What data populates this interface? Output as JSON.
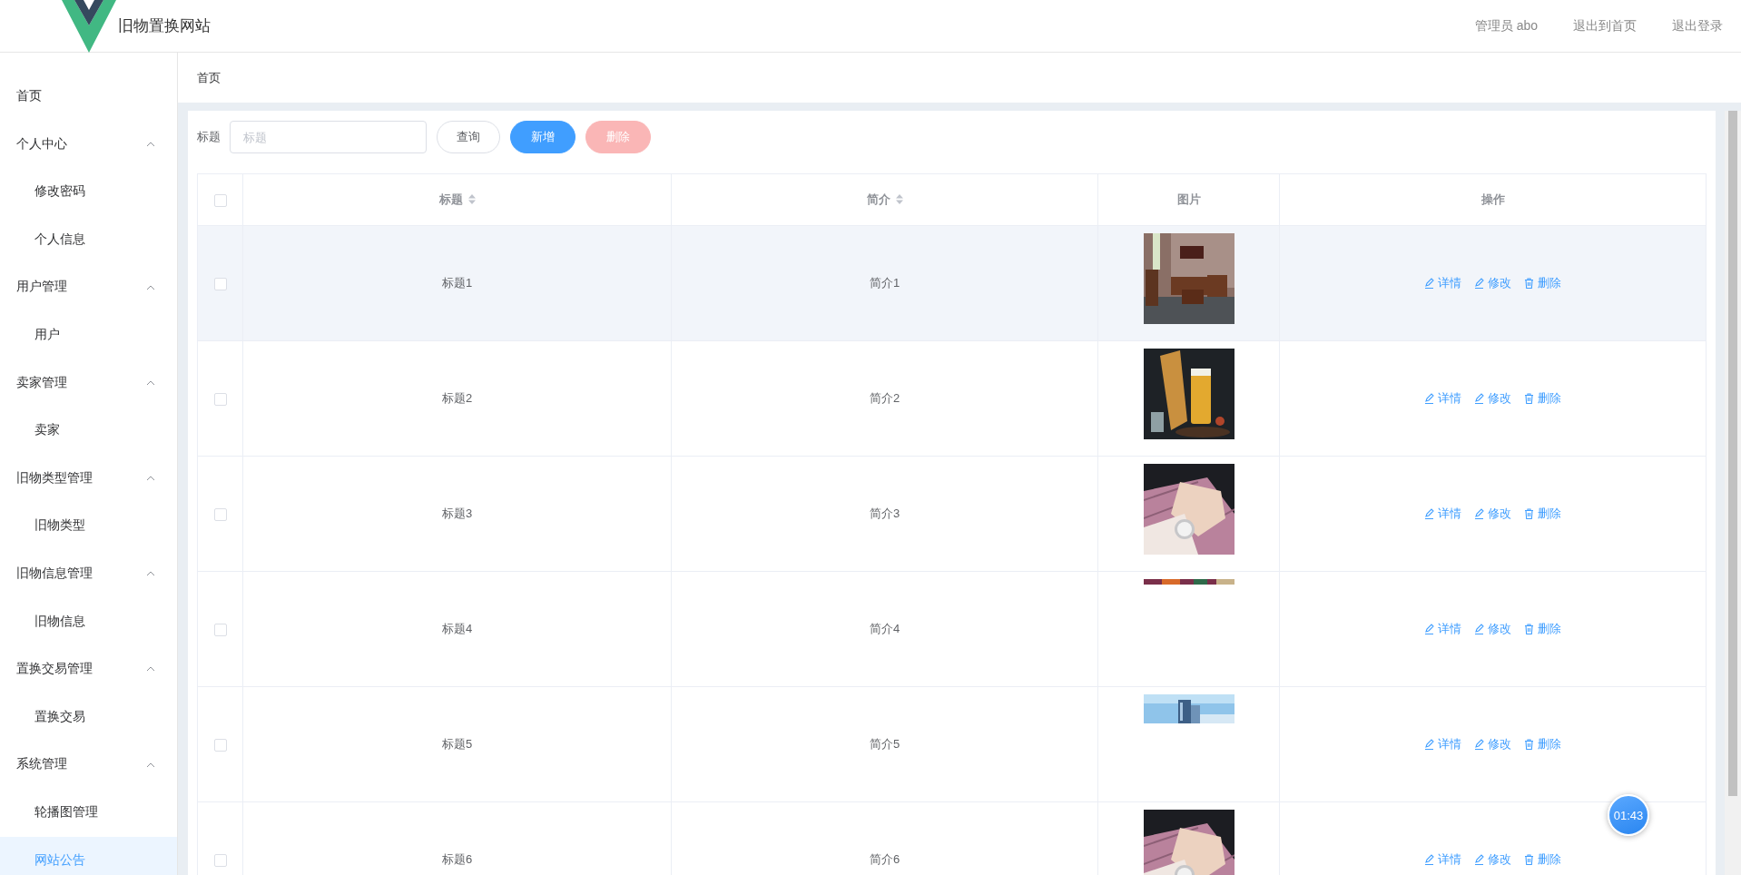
{
  "header": {
    "title": "旧物置换网站",
    "links": [
      {
        "text": "管理员 abo"
      },
      {
        "text": "退出到首页"
      },
      {
        "text": "退出登录"
      }
    ]
  },
  "sidebar": {
    "items": [
      {
        "label": "首页",
        "kind": "item",
        "selected": false
      },
      {
        "label": "个人中心",
        "kind": "group",
        "expanded": true,
        "children": [
          {
            "label": "修改密码",
            "selected": false
          },
          {
            "label": "个人信息",
            "selected": false
          }
        ]
      },
      {
        "label": "用户管理",
        "kind": "group",
        "expanded": true,
        "children": [
          {
            "label": "用户",
            "selected": false
          }
        ]
      },
      {
        "label": "卖家管理",
        "kind": "group",
        "expanded": true,
        "children": [
          {
            "label": "卖家",
            "selected": false
          }
        ]
      },
      {
        "label": "旧物类型管理",
        "kind": "group",
        "expanded": true,
        "children": [
          {
            "label": "旧物类型",
            "selected": false
          }
        ]
      },
      {
        "label": "旧物信息管理",
        "kind": "group",
        "expanded": true,
        "children": [
          {
            "label": "旧物信息",
            "selected": false
          }
        ]
      },
      {
        "label": "置换交易管理",
        "kind": "group",
        "expanded": true,
        "children": [
          {
            "label": "置换交易",
            "selected": false
          }
        ]
      },
      {
        "label": "系统管理",
        "kind": "group",
        "expanded": true,
        "children": [
          {
            "label": "轮播图管理",
            "selected": false
          },
          {
            "label": "网站公告",
            "selected": true
          }
        ]
      }
    ]
  },
  "breadcrumb": [
    "首页"
  ],
  "search": {
    "label": "标题",
    "placeholder": "标题",
    "buttons": [
      {
        "label": "查询",
        "kind": "default",
        "disabled": false
      },
      {
        "label": "新增",
        "kind": "primary",
        "disabled": false
      },
      {
        "label": "删除",
        "kind": "danger",
        "disabled": true
      }
    ]
  },
  "table": {
    "checked": false,
    "columns": [
      {
        "label": "标题",
        "sortable": true
      },
      {
        "label": "简介",
        "sortable": true
      },
      {
        "label": "图片",
        "sortable": false
      },
      {
        "label": "操作",
        "sortable": false
      }
    ],
    "rows": [
      {
        "checked": false,
        "hovered": true,
        "title": "标题1",
        "summary": "简介1",
        "image": {
          "kind": "picture"
        },
        "actions": [
          {
            "label": "详情",
            "kind": "edit"
          },
          {
            "label": "修改",
            "kind": "edit"
          },
          {
            "label": "删除",
            "kind": "delete"
          }
        ]
      },
      {
        "checked": false,
        "hovered": false,
        "title": "标题2",
        "summary": "简介2",
        "image": {
          "kind": "picture"
        },
        "actions": [
          {
            "label": "详情",
            "kind": "edit"
          },
          {
            "label": "修改",
            "kind": "edit"
          },
          {
            "label": "删除",
            "kind": "delete"
          }
        ]
      },
      {
        "checked": false,
        "hovered": false,
        "title": "标题3",
        "summary": "简介3",
        "image": {
          "kind": "picture"
        },
        "actions": [
          {
            "label": "详情",
            "kind": "edit"
          },
          {
            "label": "修改",
            "kind": "edit"
          },
          {
            "label": "删除",
            "kind": "delete"
          }
        ]
      },
      {
        "checked": false,
        "hovered": false,
        "title": "标题4",
        "summary": "简介4",
        "image": {
          "kind": "picture"
        },
        "actions": [
          {
            "label": "详情",
            "kind": "edit"
          },
          {
            "label": "修改",
            "kind": "edit"
          },
          {
            "label": "删除",
            "kind": "delete"
          }
        ]
      },
      {
        "checked": false,
        "hovered": false,
        "title": "标题5",
        "summary": "简介5",
        "image": {
          "kind": "picture"
        },
        "actions": [
          {
            "label": "详情",
            "kind": "edit"
          },
          {
            "label": "修改",
            "kind": "edit"
          },
          {
            "label": "删除",
            "kind": "delete"
          }
        ]
      },
      {
        "checked": false,
        "hovered": false,
        "title": "标题6",
        "summary": "简介6",
        "image": {
          "kind": "picture"
        },
        "actions": [
          {
            "label": "详情",
            "kind": "edit"
          },
          {
            "label": "修改",
            "kind": "edit"
          },
          {
            "label": "删除",
            "kind": "delete"
          }
        ]
      }
    ]
  },
  "timer": "01:43"
}
